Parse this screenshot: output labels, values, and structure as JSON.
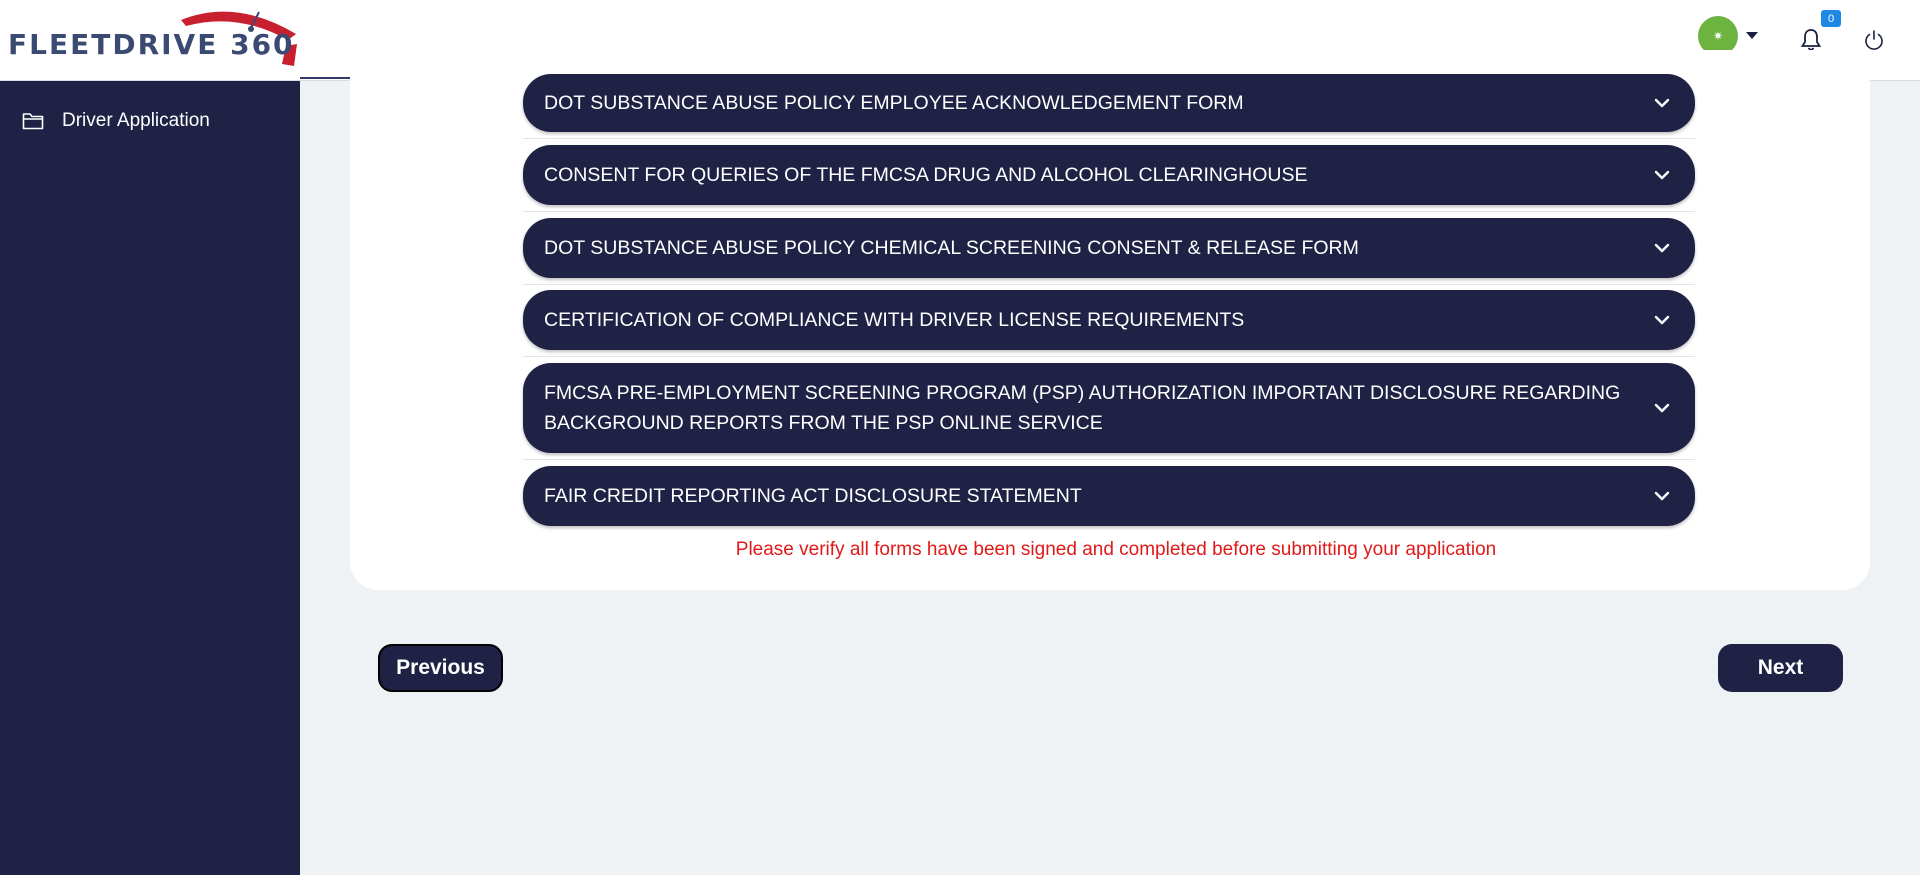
{
  "header": {
    "logo_text": "FLEETDRIVE 360",
    "avatar_glyph": "✷",
    "notification_count": "0",
    "icons": [
      "folder-icon",
      "bell-icon",
      "power-icon",
      "chevron-down-icon",
      "caret-down-icon"
    ]
  },
  "sidebar": {
    "items": [
      {
        "label": "Driver Application",
        "icon": "folder-icon"
      }
    ]
  },
  "forms": [
    {
      "title": "DOT SUBSTANCE ABUSE POLICY EMPLOYEE ACKNOWLEDGEMENT FORM"
    },
    {
      "title": "CONSENT FOR QUERIES OF THE FMCSA DRUG AND ALCOHOL CLEARINGHOUSE"
    },
    {
      "title": "DOT SUBSTANCE ABUSE POLICY CHEMICAL SCREENING CONSENT & RELEASE FORM"
    },
    {
      "title": "CERTIFICATION OF COMPLIANCE WITH DRIVER LICENSE REQUIREMENTS"
    },
    {
      "title": "FMCSA PRE-EMPLOYMENT SCREENING PROGRAM (PSP) AUTHORIZATION IMPORTANT DISCLOSURE REGARDING BACKGROUND REPORTS FROM THE PSP ONLINE SERVICE"
    },
    {
      "title": "FAIR CREDIT REPORTING ACT DISCLOSURE STATEMENT"
    }
  ],
  "warning_message": "Please verify all forms have been signed and completed before submitting your application",
  "navigation": {
    "previous_label": "Previous",
    "next_label": "Next"
  },
  "colors": {
    "navy": "#1f2244",
    "warning_red": "#e01919",
    "avatar_green": "#6db33f",
    "badge_blue": "#1e88e5",
    "logo_red": "#c8202f"
  }
}
